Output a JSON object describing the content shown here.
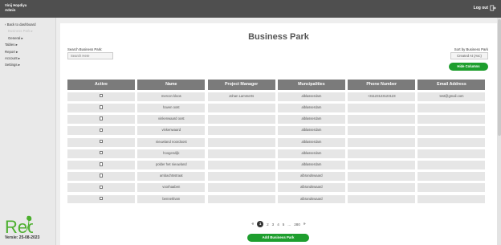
{
  "header": {
    "brand_line1": "Vinij Hopdiya",
    "brand_line2": "Admin",
    "logout_label": "Log out"
  },
  "sidebar": {
    "items": [
      {
        "label": "‹ Back to dashboard"
      },
      {
        "label": "Business Park ▸"
      },
      {
        "label": "General ▸"
      },
      {
        "label": "Tables ▸"
      },
      {
        "label": "Report ▸"
      },
      {
        "label": "Account ▸"
      },
      {
        "label": "Settings ▸"
      }
    ],
    "logo_text": "Rec",
    "version": "Versie: 25-08-2023"
  },
  "page": {
    "title": "Business Park",
    "search_label": "Search Business Park:",
    "search_placeholder": "Search Here",
    "sort_label": "Sort by Business Park",
    "sort_value": "Created At (Asc)",
    "hide_columns_label": "Hide Columns",
    "add_button_label": "Add Business Park"
  },
  "table": {
    "columns": [
      "Active",
      "Name",
      "Project Manager",
      "Muncipalities",
      "Phone Number",
      "Email Address"
    ],
    "rows": [
      {
        "name": "mercon kloos",
        "manager": "Johan Lammerts",
        "municipality": "alblasserdam",
        "phone": "+31123123123123",
        "email": "test@gmail.com"
      },
      {
        "name": "haven oost",
        "manager": "",
        "municipality": "alblasserdam",
        "phone": "",
        "email": ""
      },
      {
        "name": "vinkenwaard oost",
        "manager": "",
        "municipality": "alblasserdam",
        "phone": "",
        "email": ""
      },
      {
        "name": "vinkenwaard",
        "manager": "",
        "municipality": "alblasserdam",
        "phone": "",
        "email": ""
      },
      {
        "name": "nieuwland noordoost",
        "manager": "",
        "municipality": "alblasserdam",
        "phone": "",
        "email": ""
      },
      {
        "name": "hoogendijk",
        "manager": "",
        "municipality": "alblasserdam",
        "phone": "",
        "email": ""
      },
      {
        "name": "polder het nieuwland",
        "manager": "",
        "municipality": "alblasserdam",
        "phone": "",
        "email": ""
      },
      {
        "name": "ambachtsstraat",
        "manager": "",
        "municipality": "albrandswaard",
        "phone": "",
        "email": ""
      },
      {
        "name": "voorhaaben",
        "manager": "",
        "municipality": "albrandswaard",
        "phone": "",
        "email": ""
      },
      {
        "name": "bennekham",
        "manager": "",
        "municipality": "albrandswaard",
        "phone": "",
        "email": ""
      }
    ]
  },
  "pagination": {
    "prev": "«",
    "pages": [
      "1",
      "2",
      "3",
      "4",
      "5"
    ],
    "ellipsis": "...",
    "last": "280",
    "next": "»"
  },
  "colors": {
    "accent": "#1e9e2e",
    "header_bg": "#4f4f4f",
    "table_head": "#7b7b7b"
  }
}
